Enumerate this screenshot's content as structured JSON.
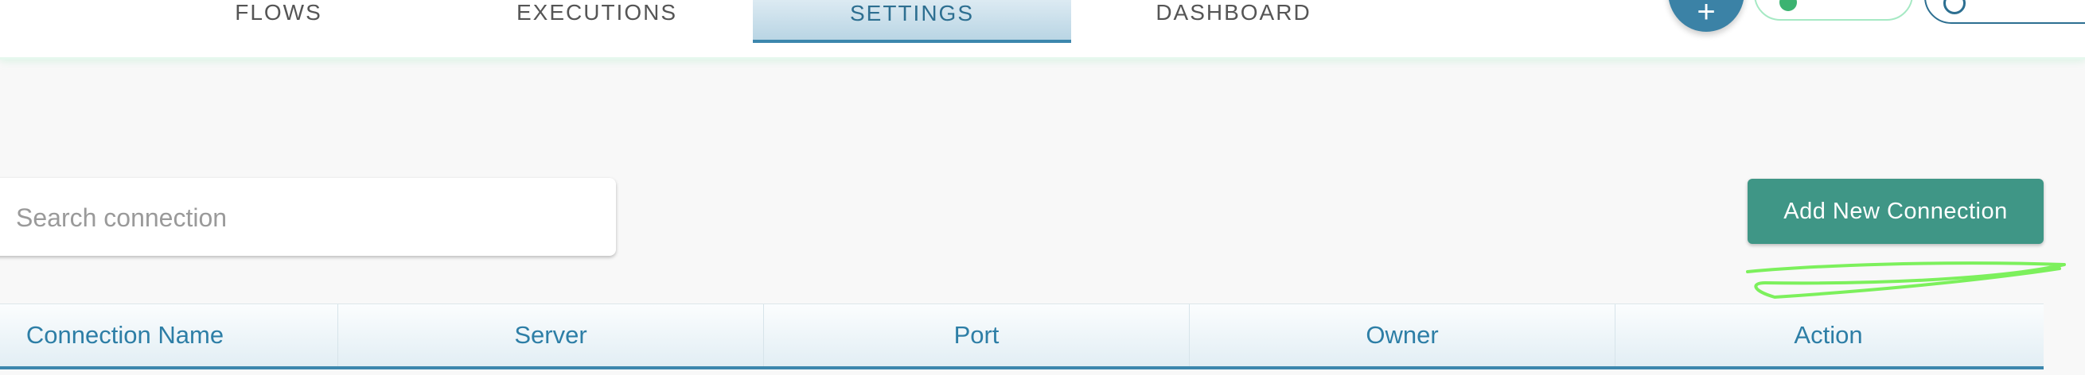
{
  "nav": {
    "tabs": [
      {
        "label": "FLOWS"
      },
      {
        "label": "EXECUTIONS"
      },
      {
        "label": "SETTINGS"
      },
      {
        "label": "DASHBOARD"
      }
    ],
    "fab_label": "+"
  },
  "search": {
    "placeholder": "Search connection",
    "value": ""
  },
  "actions": {
    "add_connection_label": "Add New Connection"
  },
  "table": {
    "columns": [
      "Connection Name",
      "Server",
      "Port",
      "Owner",
      "Action"
    ]
  },
  "colors": {
    "primary": "#3b82a6",
    "accent_button": "#3f9686",
    "header_text": "#2d7ea6",
    "annotation": "#7cf05c"
  }
}
